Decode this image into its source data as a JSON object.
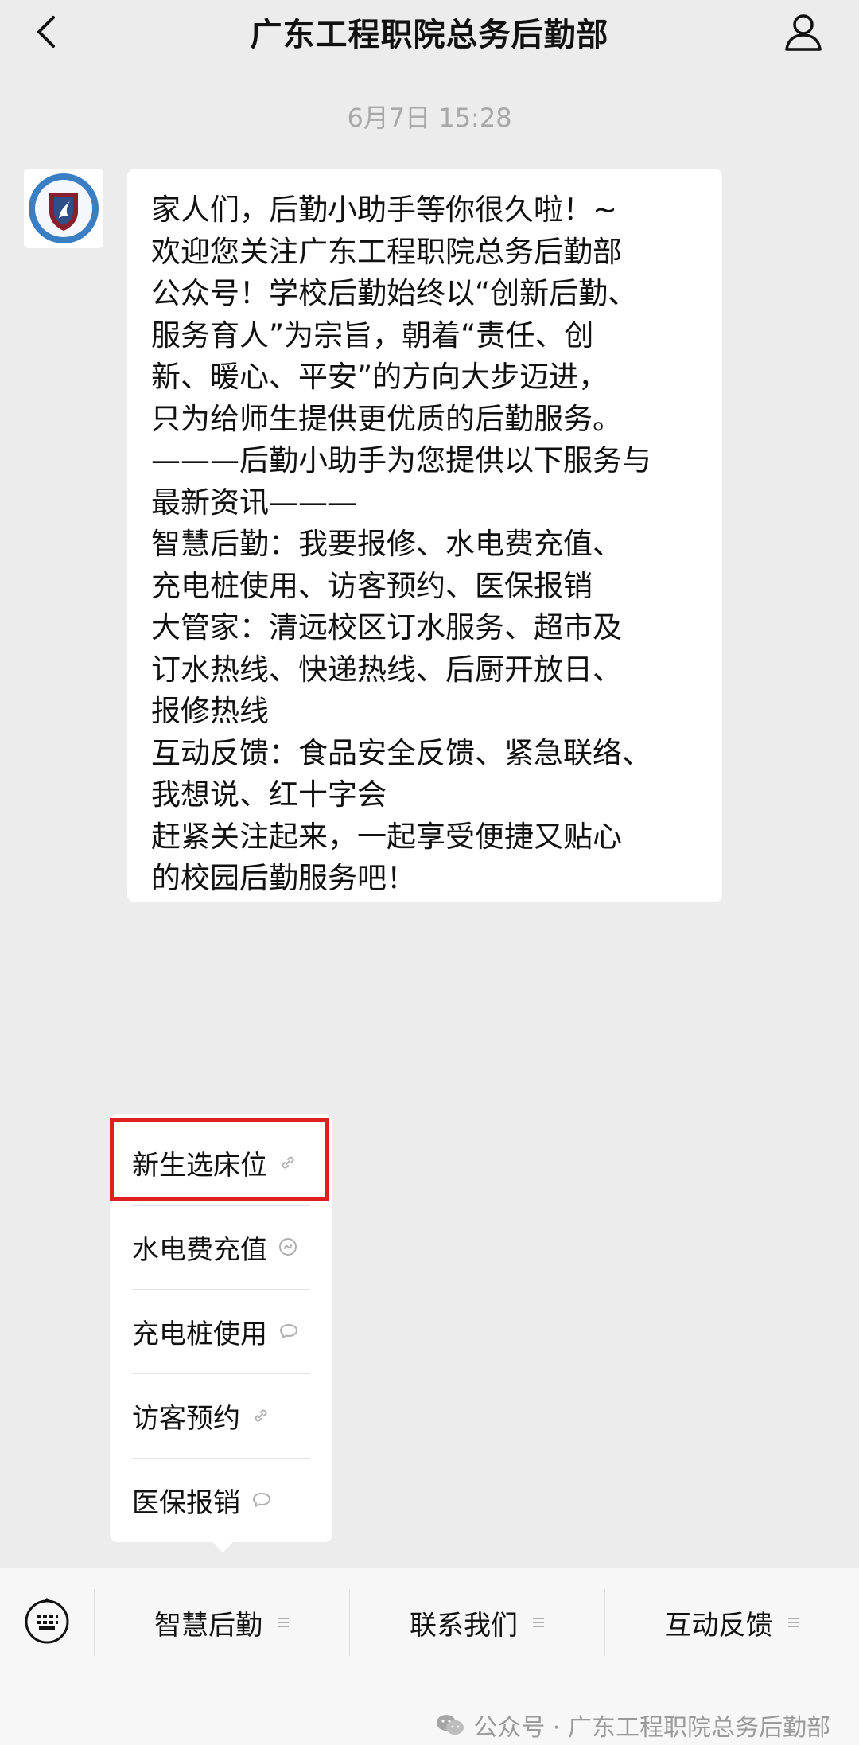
{
  "header": {
    "title": "广东工程职院总务后勤部"
  },
  "chat": {
    "timestamp": "6月7日 15:28",
    "message_lines": [
      "家人们，后勤小助手等你很久啦！~",
      "欢迎您关注广东工程职院总务后勤部",
      "公众号！学校后勤始终以“创新后勤、",
      "服务育人”为宗旨，朝着“责任、创",
      "新、暖心、平安”的方向大步迈进，",
      "只为给师生提供更优质的后勤服务。",
      "———后勤小助手为您提供以下服务与",
      "最新资讯———",
      "智慧后勤：我要报修、水电费充值、",
      "充电桩使用、访客预约、医保报销",
      "大管家：清远校区订水服务、超市及",
      "订水热线、快递热线、后厨开放日、",
      "报修热线",
      "互动反馈：食品安全反馈、紧急联络、",
      "我想说、红十字会",
      "赶紧关注起来，一起享受便捷又贴心",
      "的校园后勤服务吧！"
    ]
  },
  "submenu": {
    "items": [
      {
        "label": "新生选床位",
        "icon": "link-icon"
      },
      {
        "label": "水电费充值",
        "icon": "mini-program-icon"
      },
      {
        "label": "充电桩使用",
        "icon": "message-icon"
      },
      {
        "label": "访客预约",
        "icon": "link-icon"
      },
      {
        "label": "医保报销",
        "icon": "message-icon"
      }
    ]
  },
  "bottom_menu": {
    "tabs": [
      {
        "label": "智慧后勤",
        "icon": "menu-lines-icon"
      },
      {
        "label": "联系我们",
        "icon": "menu-lines-icon"
      },
      {
        "label": "互动反馈",
        "icon": "menu-lines-icon"
      }
    ]
  },
  "watermark": {
    "text": "公众号 · 广东工程职院总务后勤部"
  },
  "colors": {
    "background": "#ececec",
    "highlight_border": "#e02020",
    "timestamp_text": "#a8a8a8"
  }
}
